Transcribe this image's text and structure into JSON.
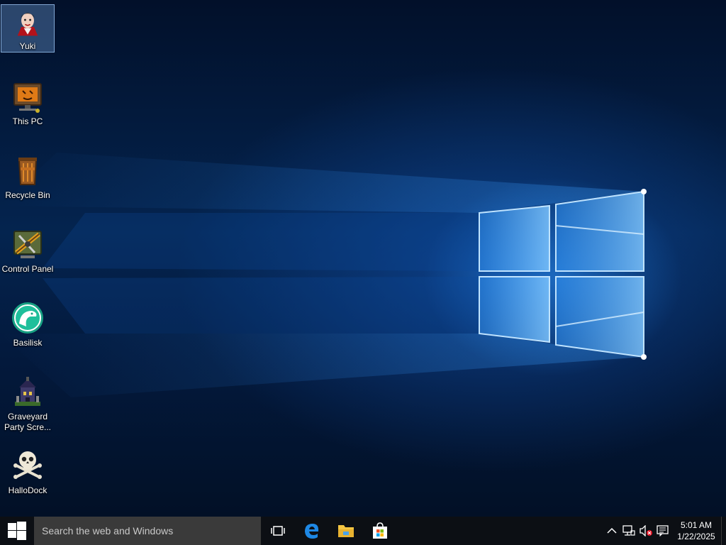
{
  "desktop": {
    "icons": [
      {
        "label": "Yuki",
        "icon": "user-avatar-icon",
        "selected": true
      },
      {
        "label": "This PC",
        "icon": "computer-icon"
      },
      {
        "label": "Recycle Bin",
        "icon": "recycle-bin-icon"
      },
      {
        "label": "Control Panel",
        "icon": "control-panel-icon"
      },
      {
        "label": "Basilisk",
        "icon": "basilisk-browser-icon"
      },
      {
        "label": "Graveyard Party Scre...",
        "label_line1": "Graveyard",
        "label_line2": "Party Scre...",
        "icon": "haunted-house-icon"
      },
      {
        "label": "HalloDock",
        "icon": "skull-crossbones-icon"
      }
    ]
  },
  "taskbar": {
    "start_icon": "windows-logo-icon",
    "search_placeholder": "Search the web and Windows",
    "pinned": [
      {
        "name": "task-view",
        "icon": "task-view-icon"
      },
      {
        "name": "edge",
        "icon": "edge-browser-icon"
      },
      {
        "name": "file-explorer",
        "icon": "folder-icon"
      },
      {
        "name": "store",
        "icon": "store-bag-icon"
      }
    ],
    "tray": {
      "icons": [
        "chevron-up-icon",
        "network-icon",
        "volume-muted-icon",
        "action-center-icon"
      ],
      "time": "5:01 AM",
      "date": "1/22/2025"
    }
  },
  "colors": {
    "taskbar_bg": "#0c0f14",
    "search_bg": "#3a3a3a",
    "edge_blue": "#1e88e5",
    "folder_yellow": "#f4c542"
  }
}
